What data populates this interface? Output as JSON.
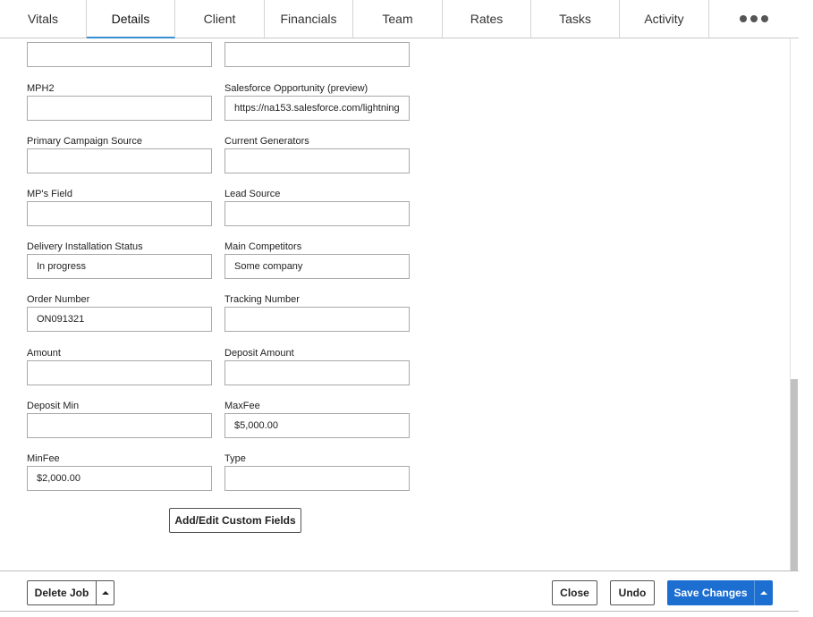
{
  "tabs": [
    "Vitals",
    "Details",
    "Client",
    "Financials",
    "Team",
    "Rates",
    "Tasks",
    "Activity"
  ],
  "tab_more_icon": "more-dots-icon",
  "active_tab": "Details",
  "fields": {
    "top_left": {
      "label": "",
      "value": ""
    },
    "top_right": {
      "label": "",
      "value": ""
    },
    "mph2": {
      "label": "MPH2",
      "value": ""
    },
    "salesforce": {
      "label": "Salesforce Opportunity (preview)",
      "value": "https://na153.salesforce.com/lightning"
    },
    "primary_campaign": {
      "label": "Primary Campaign Source",
      "value": ""
    },
    "current_generators": {
      "label": "Current Generators",
      "value": ""
    },
    "mps_field": {
      "label": "MP's Field",
      "value": ""
    },
    "lead_source": {
      "label": "Lead Source",
      "value": ""
    },
    "delivery_status": {
      "label": "Delivery Installation Status",
      "value": "In progress"
    },
    "main_competitors": {
      "label": "Main Competitors",
      "value": "Some company"
    },
    "order_number": {
      "label": "Order Number",
      "value": "ON091321"
    },
    "tracking_number": {
      "label": "Tracking Number",
      "value": ""
    },
    "amount": {
      "label": "Amount",
      "value": ""
    },
    "deposit_amount": {
      "label": "Deposit Amount",
      "value": ""
    },
    "deposit_min": {
      "label": "Deposit Min",
      "value": ""
    },
    "max_fee": {
      "label": "MaxFee",
      "value": "$5,000.00"
    },
    "min_fee": {
      "label": "MinFee",
      "value": "$2,000.00"
    },
    "type": {
      "label": "Type",
      "value": ""
    }
  },
  "custom_fields_label": "Add/Edit Custom Fields",
  "footer": {
    "delete_label": "Delete Job",
    "close_label": "Close",
    "undo_label": "Undo",
    "save_label": "Save Changes"
  },
  "colors": {
    "primary": "#1c6fd1",
    "active_tab_underline": "#3a8fd0"
  }
}
